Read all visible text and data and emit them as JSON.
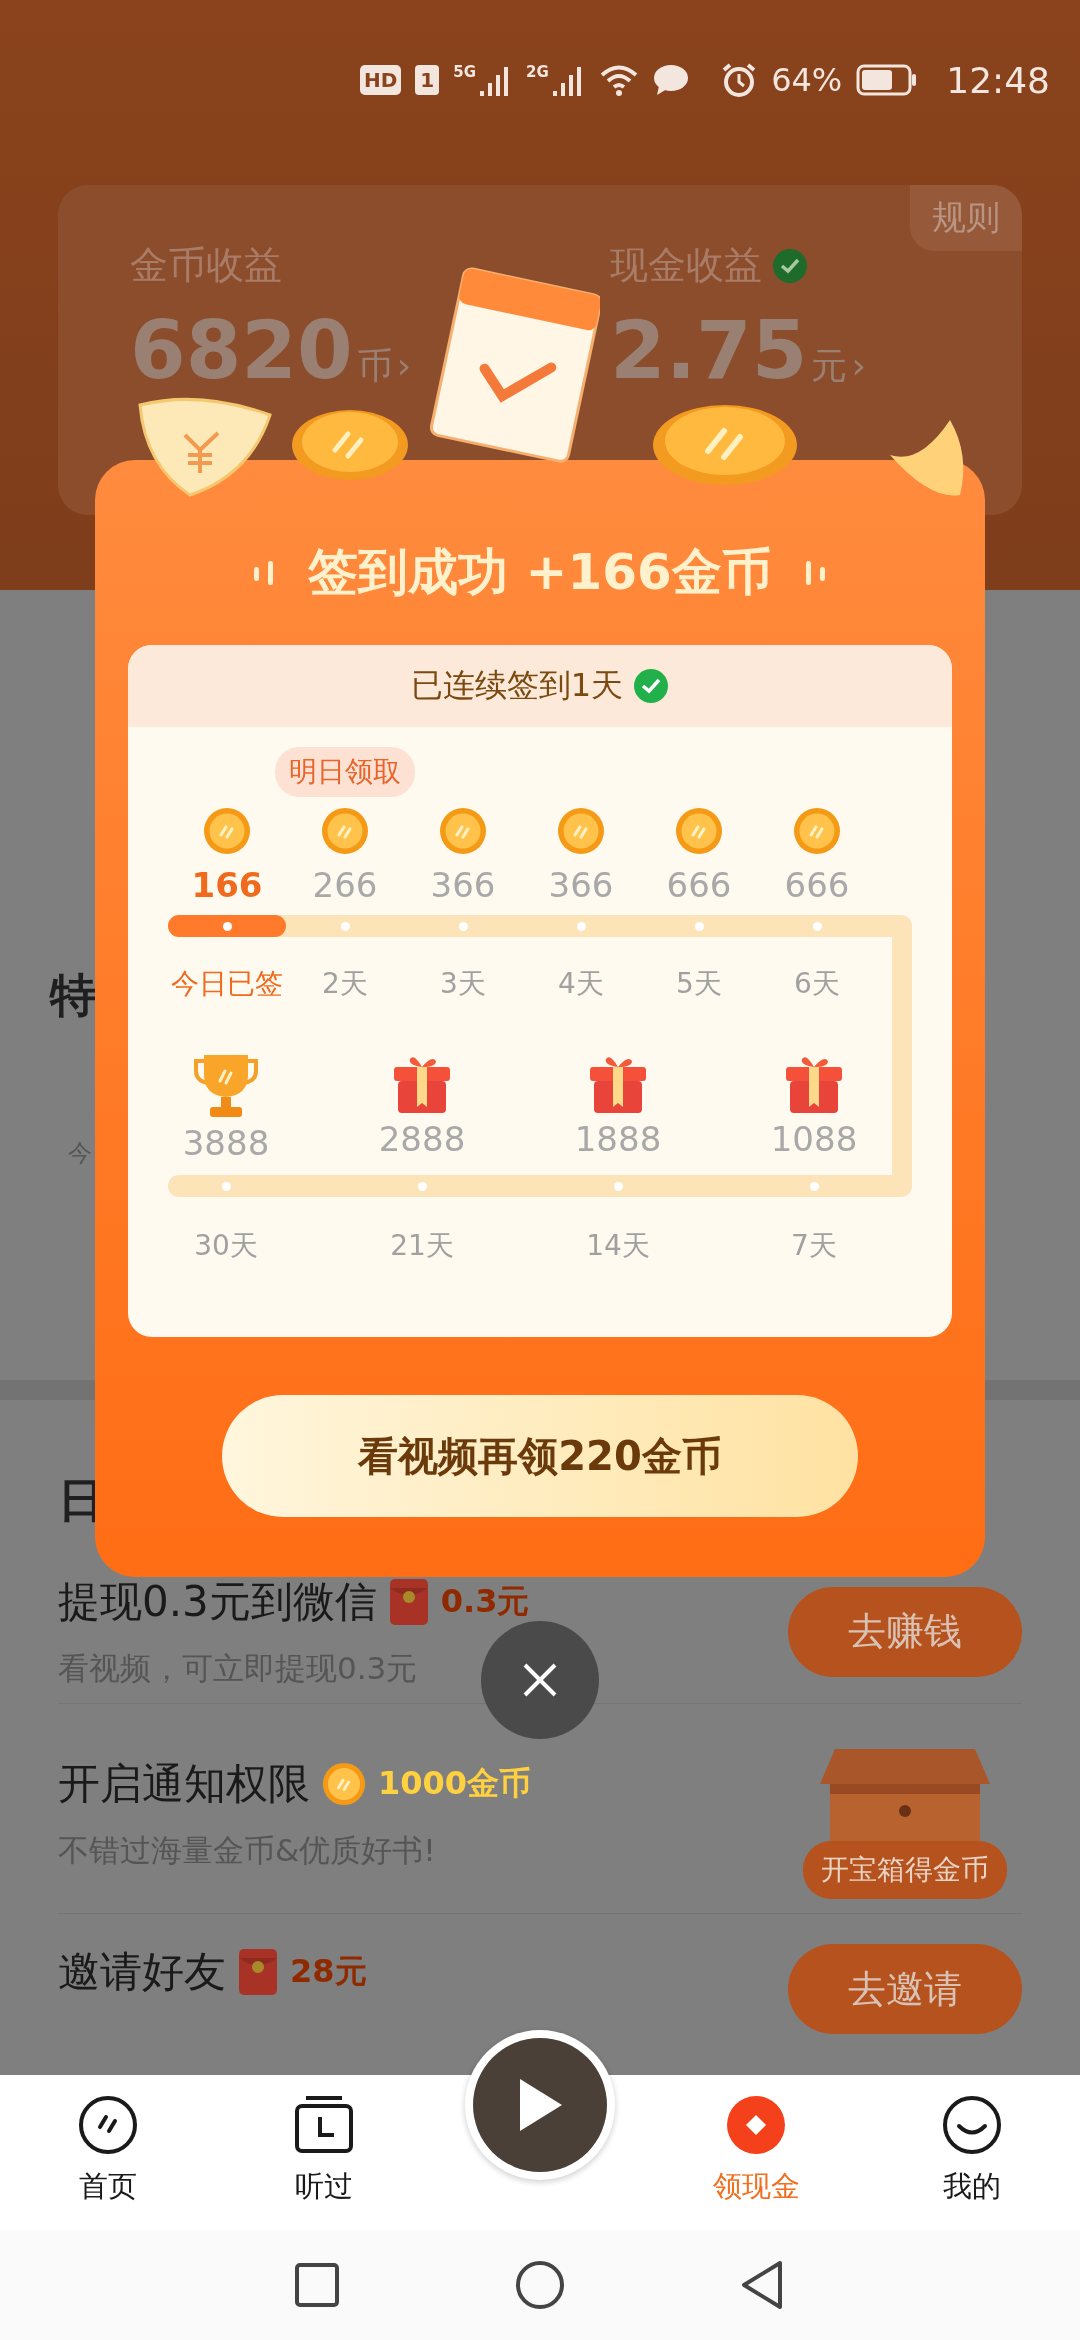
{
  "status_bar": {
    "hd_badge": "HD",
    "sim_badge": "1",
    "network_1": "5G",
    "network_2": "2G",
    "battery": "64%",
    "time": "12:48"
  },
  "header": {
    "rules": "规则",
    "coins": {
      "label": "金币收益",
      "value": "6820",
      "unit": "币",
      "chevron": "›"
    },
    "cash": {
      "label": "现金收益",
      "value": "2.75",
      "unit": "元",
      "chevron": "›"
    }
  },
  "section_headings": [
    "特",
    "日"
  ],
  "section_note": "今",
  "tasks": [
    {
      "title": "提现0.3元到微信",
      "reward": {
        "kind": "red_packet",
        "text": "0.3元"
      },
      "subtitle": "看视频，可立即提现0.3元",
      "action": {
        "kind": "button",
        "label": "去赚钱"
      }
    },
    {
      "title": "开启通知权限",
      "reward": {
        "kind": "coin",
        "text": "1000金币"
      },
      "subtitle": "不错过海量金币&优质好书!",
      "action": {
        "kind": "chest",
        "label": "开宝箱得金币"
      }
    },
    {
      "title": "邀请好友",
      "reward": {
        "kind": "red_packet",
        "text": "28元"
      },
      "action": {
        "kind": "button",
        "label": "去邀请"
      }
    }
  ],
  "modal": {
    "title": "签到成功 +166金币",
    "streak": "已连续签到1天",
    "days": [
      {
        "value": "166",
        "label": "今日已签",
        "signed": true
      },
      {
        "value": "266",
        "label": "2天",
        "signed": false,
        "tooltip": "明日领取"
      },
      {
        "value": "366",
        "label": "3天",
        "signed": false
      },
      {
        "value": "366",
        "label": "4天",
        "signed": false
      },
      {
        "value": "666",
        "label": "5天",
        "signed": false
      },
      {
        "value": "666",
        "label": "6天",
        "signed": false
      }
    ],
    "milestones": [
      {
        "kind": "trophy",
        "value": "3888",
        "label": "30天"
      },
      {
        "kind": "gift",
        "value": "2888",
        "label": "21天"
      },
      {
        "kind": "gift",
        "value": "1888",
        "label": "14天"
      },
      {
        "kind": "gift",
        "value": "1088",
        "label": "7天"
      }
    ],
    "cta": "看视频再领220金币"
  },
  "nav": [
    {
      "kind": "home",
      "label": "首页",
      "selected": false
    },
    {
      "kind": "history",
      "label": "听过",
      "selected": false
    },
    {
      "kind": "player"
    },
    {
      "kind": "cash",
      "label": "领现金",
      "selected": true
    },
    {
      "kind": "profile",
      "label": "我的",
      "selected": false
    }
  ]
}
